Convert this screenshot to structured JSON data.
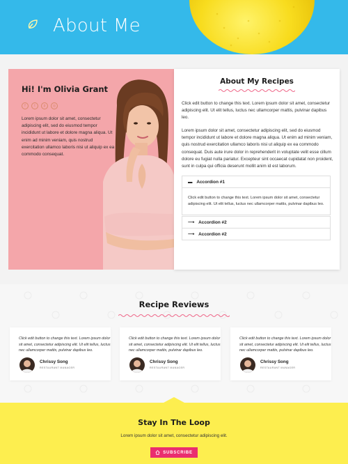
{
  "hero": {
    "title": "About Me",
    "bg_color": "#34b9ea",
    "icon": "leaf-icon"
  },
  "profile": {
    "heading": "Hi! I'm Olivia Grant",
    "social_icons": [
      "facebook-icon",
      "twitter-icon",
      "pinterest-icon",
      "instagram-icon"
    ],
    "bio": "Lorem ipsum dolor sit amet, consectetur adipiscing elit, sed do eiusmod tempor incididunt ut labore et dolore magna aliqua. Ut enim ad minim veniam, quis nostrud exercitation ullamco laboris nisi ut aliquip ex ea commodo consequat.",
    "bg_color": "#f4a6aa"
  },
  "recipes": {
    "title": "About My Recipes",
    "para1": "Click edit button to change this text. Lorem ipsum dolor sit amet, consectetur adipiscing elit. Ut elit tellus, luctus nec ullamcorper mattis, pulvinar dapibus leo.",
    "para2": "Lorem ipsum dolor sit amet, consectetur adipiscing elit, sed do eiusmod tempor incididunt ut labore et dolore magna aliqua. Ut enim ad minim veniam, quis nostrud exercitation ullamco laboris nisi ut aliquip ex ea commodo consequat. Duis aute irure dolor in reprehenderit in voluptate velit esse cillum dolore eu fugiat nulla pariatur. Excepteur sint occaecat cupidatat non proident, sunt in culpa qui officia deserunt mollit anim id est laborum.",
    "accordion": [
      {
        "label": "Accordion #1",
        "expanded": true,
        "body": "Click edit button to change this text. Lorem ipsum dolor sit amet, consectetur adipiscing elit. Ut elit tellus, luctus nec ullamcorper mattis, pulvinar dapibus leo."
      },
      {
        "label": "Accordion #2",
        "expanded": false
      },
      {
        "label": "Accordion #2",
        "expanded": false
      }
    ]
  },
  "reviews": {
    "title": "Recipe Reviews",
    "items": [
      {
        "text": "Click edit button to change this text. Lorem ipsum dolor sit amet, consectetur adipiscing elit. Ut elit tellus, luctus nec ullamcorper mattis, pulvinar dapibus leo.",
        "name": "Chrissy Song",
        "role": "RESTAURANT MANAGER"
      },
      {
        "text": "Click edit button to change this text. Lorem ipsum dolor sit amet, consectetur adipiscing elit. Ut elit tellus, luctus nec ullamcorper mattis, pulvinar dapibus leo.",
        "name": "Chrissy Song",
        "role": "RESTAURANT MANAGER"
      },
      {
        "text": "Click edit button to change this text. Lorem ipsum dolor sit amet, consectetur adipiscing elit. Ut elit tellus, luctus nec ullamcorper mattis, pulvinar dapibus leo.",
        "name": "Chrissy Song",
        "role": "RESTAURANT MANAGER"
      }
    ]
  },
  "newsletter": {
    "title": "Stay In The Loop",
    "text": "Lorem ipsum dolor sit amet, consectetur adipiscing elit.",
    "button_label": "SUBSCRIBE",
    "button_color": "#ea2e6f",
    "bg_color": "#fdee4f"
  },
  "colors": {
    "accent_pink": "#ea2e6f",
    "squiggle": "#ef6b8c"
  }
}
